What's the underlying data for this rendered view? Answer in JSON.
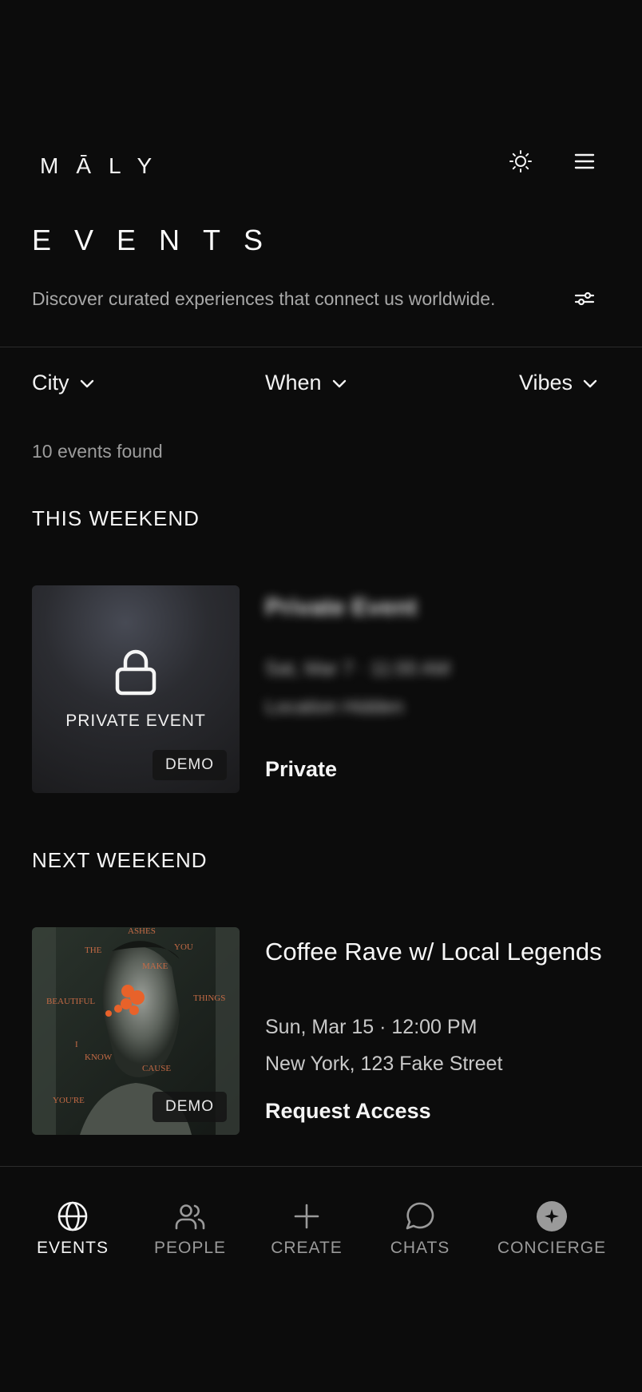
{
  "header": {
    "logo": "MĀLY",
    "title": "EVENTS",
    "subtitle": "Discover curated experiences that connect us worldwide."
  },
  "filters": {
    "city": "City",
    "when": "When",
    "vibes": "Vibes"
  },
  "results": {
    "count_text": "10 events found"
  },
  "sections": [
    {
      "title": "THIS WEEKEND",
      "event": {
        "image_label": "PRIVATE EVENT",
        "badge": "DEMO",
        "blurred_title": "Private Event",
        "blurred_date": "Sat, Mar 7 · 11:00 AM",
        "blurred_location": "Location Hidden",
        "status": "Private"
      }
    },
    {
      "title": "NEXT WEEKEND",
      "event": {
        "badge": "DEMO",
        "title": "Coffee Rave w/ Local Legends",
        "date": "Sun, Mar 15 · 12:00 PM",
        "location": "New York, 123 Fake Street",
        "action": "Request Access"
      }
    }
  ],
  "nav": {
    "events": "EVENTS",
    "people": "PEOPLE",
    "create": "CREATE",
    "chats": "CHATS",
    "concierge": "CONCIERGE",
    "active": "events"
  },
  "colors": {
    "background": "#0c0c0c",
    "text_primary": "#f5f5f5",
    "text_secondary": "#a8a8a8",
    "accent_flowers": "#e8622a"
  }
}
